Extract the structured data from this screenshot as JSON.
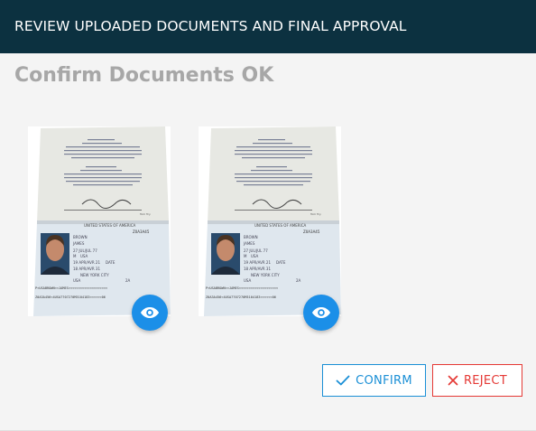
{
  "header": {
    "title": "REVIEW UPLOADED DOCUMENTS AND FINAL APPROVAL"
  },
  "page": {
    "title": "Confirm Documents OK"
  },
  "documents": [
    {
      "name": "passport-document-1",
      "view_icon": "eye-icon"
    },
    {
      "name": "passport-document-2",
      "view_icon": "eye-icon"
    }
  ],
  "passport_text": {
    "country": "UNITED STATES OF AMERICA",
    "number": "Z0A3A45",
    "surname": "BROWN",
    "given": "JAMES",
    "nationality": "USA",
    "dob": "27 JUL/JUL 77",
    "issue": "19 APR/AVR 21",
    "expiry": "18 APR/AVR 31",
    "place": "NEW YORK CITY",
    "authority": "USA",
    "mrz1": "P<USABROWN<<JAMES<<<<<<<<<<<<<<<<<<<<<<<<<<<<",
    "mrz2": "Z0A3A456<4USA7707270M3104183<<<<<<<<<<<<<<06"
  },
  "actions": {
    "confirm_label": "CONFIRM",
    "reject_label": "REJECT"
  },
  "colors": {
    "header_bg": "#0c3140",
    "accent": "#1b8fe8",
    "danger": "#e53935"
  }
}
